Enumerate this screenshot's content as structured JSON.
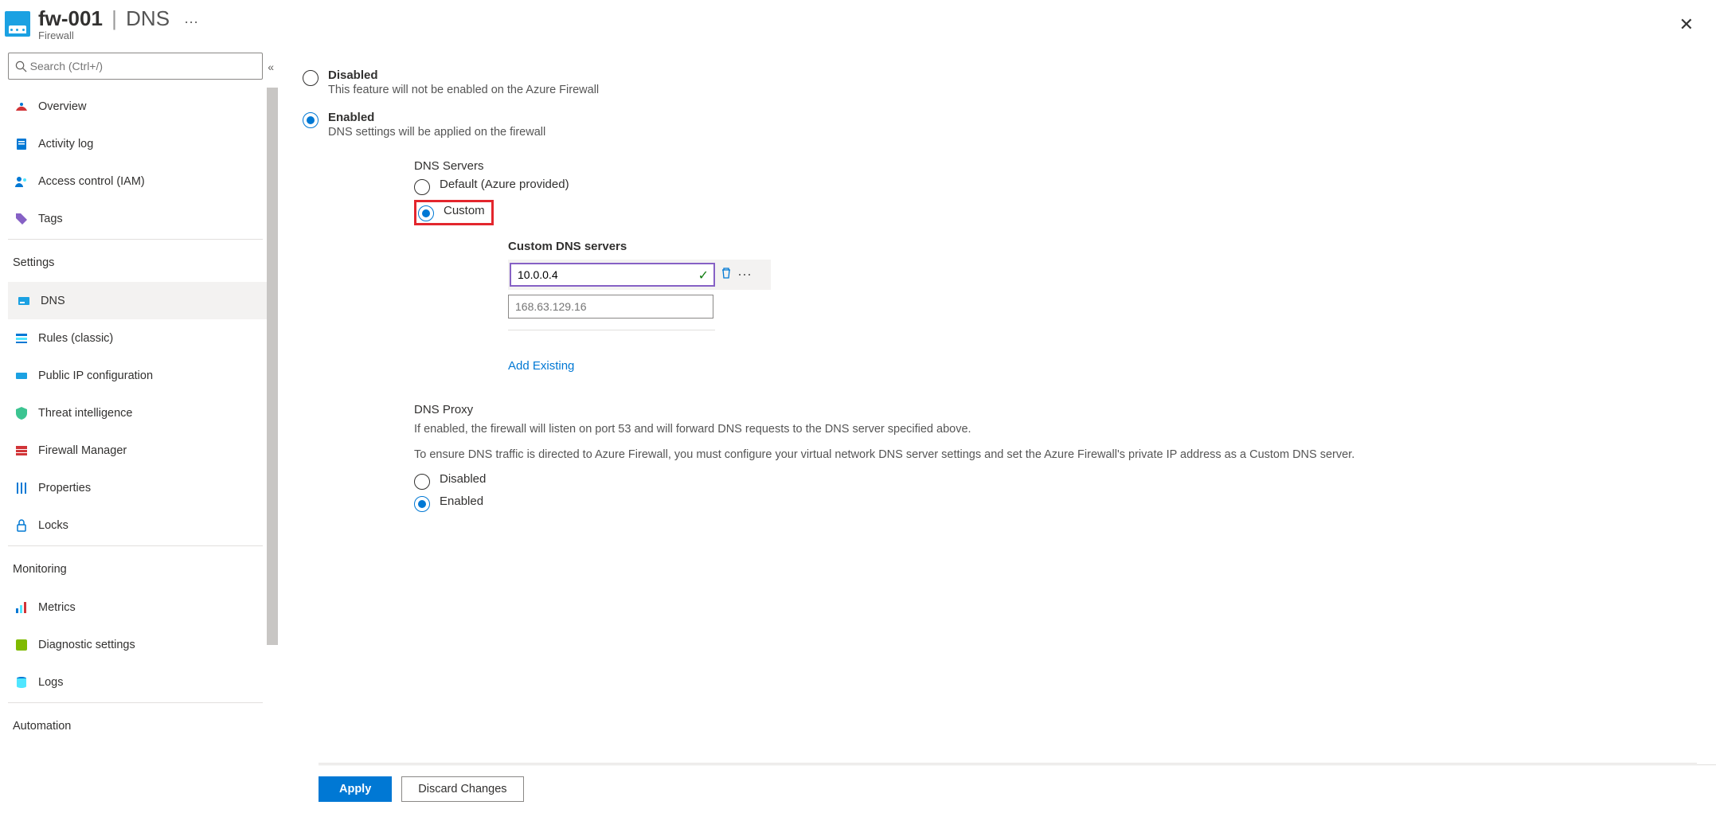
{
  "header": {
    "resource_name": "fw-001",
    "section": "DNS",
    "subtitle": "Firewall"
  },
  "search": {
    "placeholder": "Search (Ctrl+/)"
  },
  "nav": {
    "overview": "Overview",
    "activity_log": "Activity log",
    "access_control": "Access control (IAM)",
    "tags": "Tags",
    "settings_header": "Settings",
    "dns": "DNS",
    "rules": "Rules (classic)",
    "public_ip": "Public IP configuration",
    "threat": "Threat intelligence",
    "fw_manager": "Firewall Manager",
    "properties": "Properties",
    "locks": "Locks",
    "monitoring_header": "Monitoring",
    "metrics": "Metrics",
    "diagnostic": "Diagnostic settings",
    "logs": "Logs",
    "automation_header": "Automation"
  },
  "dns": {
    "disabled_label": "Disabled",
    "disabled_desc": "This feature will not be enabled on the Azure Firewall",
    "enabled_label": "Enabled",
    "enabled_desc": "DNS settings will be applied on the firewall",
    "servers_header": "DNS Servers",
    "server_default": "Default (Azure provided)",
    "server_custom": "Custom",
    "custom_header": "Custom DNS servers",
    "server1": "10.0.0.4",
    "server2_placeholder": "168.63.129.16",
    "add_existing": "Add Existing",
    "proxy_header": "DNS Proxy",
    "proxy_desc1": "If enabled, the firewall will listen on port 53 and will forward DNS requests to the DNS server specified above.",
    "proxy_desc2": "To ensure DNS traffic is directed to Azure Firewall, you must configure your virtual network DNS server settings and set the Azure Firewall's private IP address as a Custom DNS server.",
    "proxy_disabled": "Disabled",
    "proxy_enabled": "Enabled"
  },
  "buttons": {
    "apply": "Apply",
    "discard": "Discard Changes"
  }
}
